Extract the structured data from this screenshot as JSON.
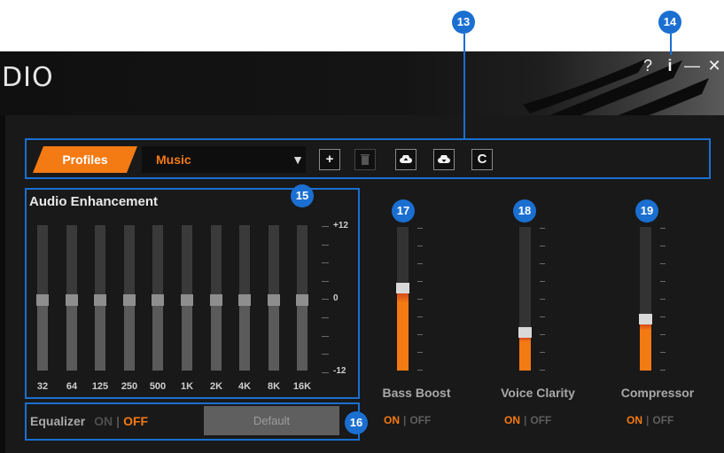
{
  "window": {
    "title": "DIO"
  },
  "titlebar": {
    "help": "?",
    "info": "i",
    "minimize": "—",
    "close": "✕"
  },
  "callouts": [
    "13",
    "14",
    "15",
    "16",
    "17",
    "18",
    "19"
  ],
  "profiles": {
    "tab_label": "Profiles",
    "selected": "Music",
    "arrow": "▼",
    "buttons": {
      "add": "+",
      "delete": "🗑",
      "upload": "☁",
      "download": "☁",
      "reset": "C"
    }
  },
  "audio_enhancement": {
    "title": "Audio Enhancement",
    "bands": [
      "32",
      "64",
      "125",
      "250",
      "500",
      "1K",
      "2K",
      "4K",
      "8K",
      "16K"
    ],
    "band_levels_db": [
      0,
      0,
      0,
      0,
      0,
      0,
      0,
      0,
      0,
      0
    ],
    "scale": {
      "max": "+12",
      "mid": "0",
      "min": "-12"
    }
  },
  "meters": [
    {
      "label": "Bass Boost",
      "level": 0.54,
      "on": "ON",
      "off": "OFF",
      "state": "ON"
    },
    {
      "label": "Voice Clarity",
      "level": 0.23,
      "on": "ON",
      "off": "OFF",
      "state": "ON"
    },
    {
      "label": "Compressor",
      "level": 0.32,
      "on": "ON",
      "off": "OFF",
      "state": "ON"
    }
  ],
  "equalizer": {
    "label": "Equalizer",
    "on": "ON",
    "off": "OFF",
    "state": "OFF",
    "default_button": "Default"
  },
  "colors": {
    "accent": "#f47a14",
    "callout": "#1a6fd1",
    "background": "#191919"
  }
}
